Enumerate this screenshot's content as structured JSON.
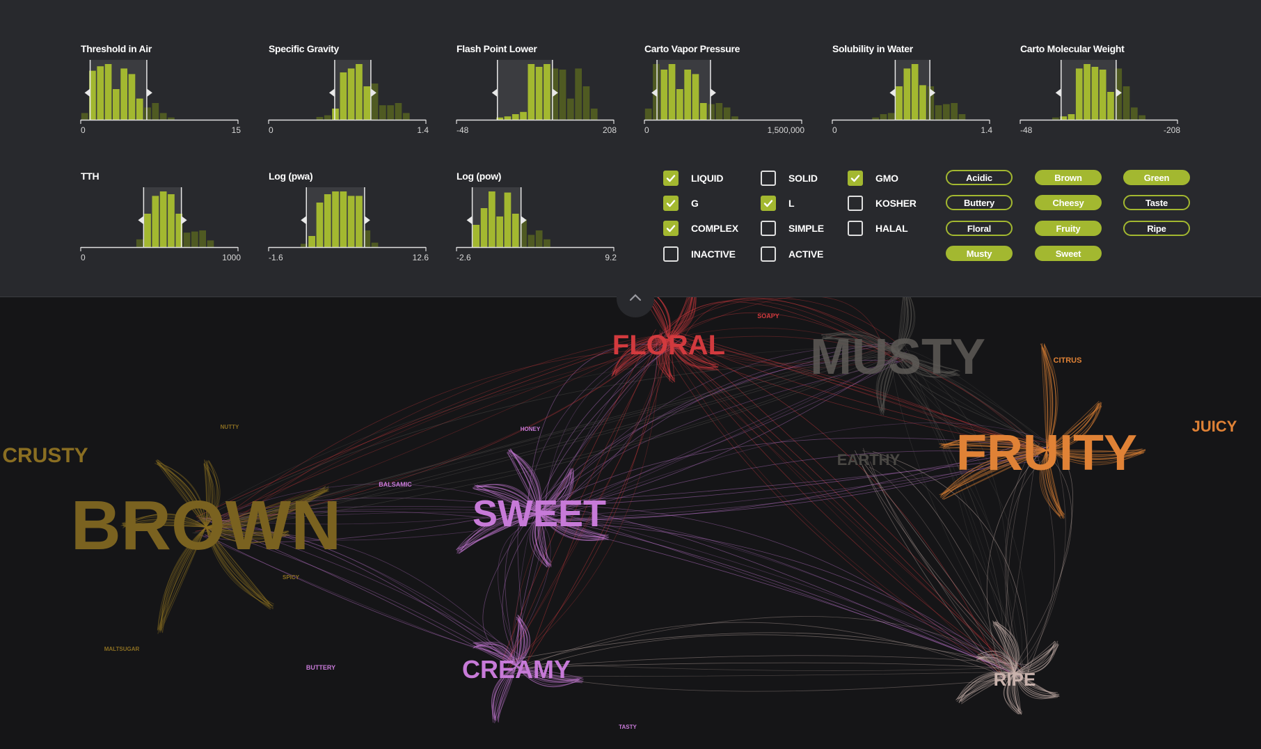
{
  "histograms": [
    {
      "title": "Threshold in Air",
      "min": "0",
      "max": "15",
      "bars": [
        0.12,
        0.88,
        0.96,
        1.0,
        0.55,
        0.92,
        0.82,
        0.38,
        0.22,
        0.3,
        0.12,
        0.04,
        0,
        0,
        0,
        0,
        0,
        0,
        0,
        0
      ],
      "sel": [
        0.06,
        0.42
      ]
    },
    {
      "title": "Specific Gravity",
      "min": "0",
      "max": "1.4",
      "bars": [
        0,
        0,
        0,
        0,
        0,
        0,
        0.05,
        0.08,
        0.2,
        0.85,
        0.92,
        1.0,
        0.6,
        0.65,
        0.26,
        0.26,
        0.3,
        0.12,
        0,
        0
      ],
      "sel": [
        0.42,
        0.65
      ]
    },
    {
      "title": "Flash Point Lower",
      "min": "-48",
      "max": "208",
      "bars": [
        0,
        0,
        0,
        0,
        0,
        0.04,
        0.06,
        0.1,
        0.14,
        1.0,
        0.95,
        1.0,
        0.92,
        0.9,
        0.38,
        0.92,
        0.6,
        0.2,
        0,
        0
      ],
      "sel": [
        0.26,
        0.61
      ]
    },
    {
      "title": "Carto Vapor Pressure",
      "min": "0",
      "max": "1,500,000",
      "bars": [
        0.2,
        1.0,
        0.9,
        1.0,
        0.55,
        0.9,
        0.82,
        0.3,
        0.28,
        0.3,
        0.22,
        0.06,
        0,
        0,
        0,
        0,
        0,
        0,
        0,
        0
      ],
      "sel": [
        0.08,
        0.42
      ]
    },
    {
      "title": "Solubility in Water",
      "min": "0",
      "max": "1.4",
      "bars": [
        0,
        0,
        0,
        0,
        0,
        0.04,
        0.1,
        0.12,
        0.6,
        0.92,
        1.0,
        0.62,
        0.6,
        0.26,
        0.28,
        0.3,
        0.1,
        0,
        0,
        0
      ],
      "sel": [
        0.4,
        0.62
      ]
    },
    {
      "title": "Carto Molecular Weight",
      "min": "-48",
      "max": "-208",
      "bars": [
        0,
        0,
        0,
        0,
        0.04,
        0.06,
        0.1,
        0.92,
        1.0,
        0.95,
        0.9,
        0.5,
        0.92,
        0.6,
        0.22,
        0.08,
        0,
        0,
        0,
        0
      ],
      "sel": [
        0.26,
        0.61
      ]
    },
    {
      "title": "TTH",
      "min": "0",
      "max": "1000",
      "bars": [
        0,
        0,
        0,
        0,
        0,
        0,
        0,
        0.14,
        0.6,
        0.92,
        1.0,
        0.95,
        0.6,
        0.26,
        0.28,
        0.3,
        0.12,
        0,
        0,
        0
      ],
      "sel": [
        0.4,
        0.64
      ]
    },
    {
      "title": "Log (pwa)",
      "min": "-1.6",
      "max": "12.6",
      "bars": [
        0,
        0,
        0,
        0,
        0.06,
        0.2,
        0.8,
        0.95,
        1.0,
        1.0,
        0.92,
        0.92,
        0.3,
        0.08,
        0,
        0,
        0,
        0,
        0,
        0
      ],
      "sel": [
        0.24,
        0.61
      ]
    },
    {
      "title": "Log (pow)",
      "min": "-2.6",
      "max": "9.2",
      "bars": [
        0,
        0,
        0.4,
        0.7,
        1.0,
        0.55,
        0.98,
        0.6,
        0.5,
        0.22,
        0.3,
        0.14,
        0,
        0,
        0,
        0,
        0,
        0,
        0,
        0
      ],
      "sel": [
        0.1,
        0.41
      ]
    }
  ],
  "checkboxes": [
    {
      "label": "LIQUID",
      "checked": true
    },
    {
      "label": "G",
      "checked": true
    },
    {
      "label": "COMPLEX",
      "checked": true
    },
    {
      "label": "INACTIVE",
      "checked": false
    },
    {
      "label": "SOLID",
      "checked": false
    },
    {
      "label": "L",
      "checked": true
    },
    {
      "label": "SIMPLE",
      "checked": false
    },
    {
      "label": "ACTIVE",
      "checked": false
    },
    {
      "label": "GMO",
      "checked": true
    },
    {
      "label": "KOSHER",
      "checked": false
    },
    {
      "label": "HALAL",
      "checked": false
    }
  ],
  "tags": [
    {
      "label": "Acidic",
      "on": false
    },
    {
      "label": "Buttery",
      "on": false
    },
    {
      "label": "Floral",
      "on": false
    },
    {
      "label": "Musty",
      "on": true
    },
    {
      "label": "Brown",
      "on": true
    },
    {
      "label": "Cheesy",
      "on": true
    },
    {
      "label": "Fruity",
      "on": true
    },
    {
      "label": "Sweet",
      "on": true
    },
    {
      "label": "Green",
      "on": true
    },
    {
      "label": "Taste",
      "on": false
    },
    {
      "label": "Ripe",
      "on": false
    }
  ],
  "network": {
    "main_labels": {
      "floral": "FLORAL",
      "musty": "MUSTY",
      "fruity": "FRUITY",
      "sweet": "SWEET",
      "brown": "BROWN",
      "creamy": "CREAMY",
      "ripe": "RIPE",
      "crusty": "CRUSTY",
      "juicy": "JUICY",
      "earthy": "EARTHY"
    },
    "minor_labels": {
      "soapy": "SOAPY",
      "citrus": "CITRUS",
      "balsamic": "BALSAMIC",
      "buttery": "BUTTERY",
      "spicy": "SPICY",
      "maltsugar": "MALTSUGAR",
      "honey": "HONEY",
      "nutty": "NUTTY",
      "tasty": "TASTY"
    },
    "colors": {
      "accent": "#a3b830",
      "floral": "#d23a3e",
      "musty": "#5e5b57",
      "fruity": "#e08236",
      "sweet": "#c77ad8",
      "brown": "#8a6e22",
      "creamy": "#c77ad8",
      "ripe": "#c9b3ad",
      "earthy": "#4a4844"
    }
  },
  "icons": {
    "collapse": "chevron-up-icon",
    "check": "check-icon"
  }
}
